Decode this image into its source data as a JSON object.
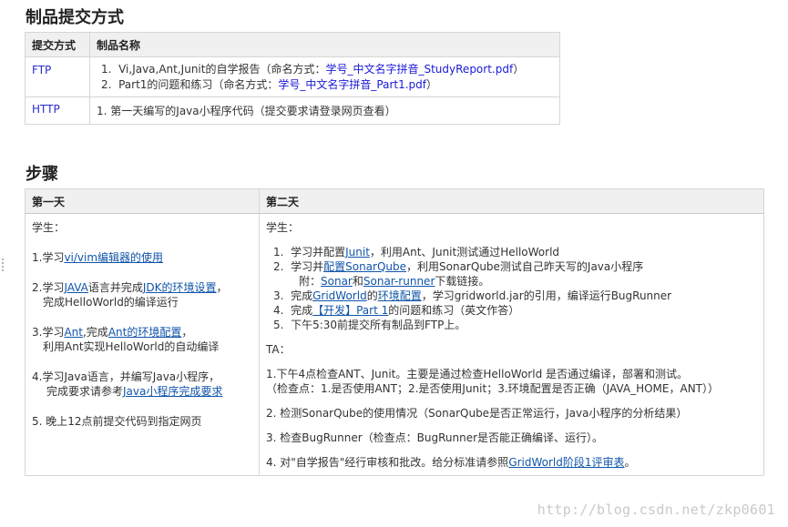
{
  "section1": {
    "title": "制品提交方式",
    "headers": [
      "提交方式",
      "制品名称"
    ],
    "rows": [
      {
        "protocol": "FTP",
        "items": [
          {
            "num": "1.",
            "text": "Vi,Java,Ant,Junit的自学报告（命名方式：",
            "highlight": "学号_中文名字拼音_StudyReport.pdf",
            "end": "）"
          },
          {
            "num": "2.",
            "text": "Part1的问题和练习（命名方式：",
            "highlight": "学号_中文名字拼音_Part1.pdf",
            "end": "）"
          }
        ]
      },
      {
        "protocol": "HTTP",
        "items": [
          {
            "num": "1.",
            "text": "第一天编写的Java小程序代码（提交要求请登录网页查看）"
          }
        ]
      }
    ]
  },
  "section2": {
    "title": "步骤",
    "headers": [
      "第一天",
      "第二天"
    ],
    "day1": {
      "student_label": "学生：",
      "items": [
        {
          "a": "1.学习",
          "link": "vi/vim编辑器的使用"
        },
        {
          "a": "2.学习",
          "link1": "JAVA",
          "b": "语言并完成",
          "link2": "JDK的环境设置",
          "c": "，",
          "line2": "完成HelloWorld的编译运行"
        },
        {
          "a": "3.学习",
          "link1": "Ant",
          "b": ",完成",
          "link2": "Ant的环境配置",
          "c": "，",
          "line2": "利用Ant实现HelloWorld的自动编译"
        },
        {
          "a": "4.学习Java语言，并编写Java小程序，",
          "line2a": "完成要求请参考",
          "link": "Java小程序完成要求"
        },
        {
          "a": "5. 晚上12点前提交代码到指定网页"
        }
      ]
    },
    "day2": {
      "student_label": "学生：",
      "items": [
        {
          "num": "1.",
          "a": "学习并配置",
          "link1": "Junit",
          "b": "，利用Ant、Junit测试通过HelloWorld"
        },
        {
          "num": "2.",
          "a": "学习并",
          "link1": "配置SonarQube",
          "b": "，利用SonarQube测试自己昨天写的Java小程序",
          "line2a": "附：",
          "link2": "Sonar",
          "line2b": "和",
          "link3": "Sonar-runner",
          "line2c": "下载链接。"
        },
        {
          "num": "3.",
          "a": "完成",
          "link1": "GridWorld",
          "b": "的",
          "link2": "环境配置",
          "c": "，学习gridworld.jar的引用，编译运行BugRunner"
        },
        {
          "num": "4.",
          "a": "完成",
          "link1": "【开发】Part 1",
          "b": "的问题和练习（英文作答）"
        },
        {
          "num": "5.",
          "a": "下午5:30前提交所有制品到FTP上。"
        }
      ],
      "ta_label": "TA：",
      "ta_items": [
        {
          "line1": "1.下午4点检查ANT、Junit。主要是通过检查HelloWorld 是否通过编译，部署和测试。",
          "line2": "（检查点：1.是否使用ANT；2.是否使用Junit；3.环境配置是否正确（JAVA_HOME，ANT））"
        },
        {
          "line1": "2. 检测SonarQube的使用情况（SonarQube是否正常运行，Java小程序的分析结果）"
        },
        {
          "line1": "3. 检查BugRunner（检查点：BugRunner是否能正确编译、运行）。"
        },
        {
          "line1": "4. 对\"自学报告\"经行审核和批改。给分标准请参照",
          "link": "GridWorld阶段1评审表",
          "end": "。"
        }
      ]
    }
  },
  "watermark": "http://blog.csdn.net/zkp0601"
}
